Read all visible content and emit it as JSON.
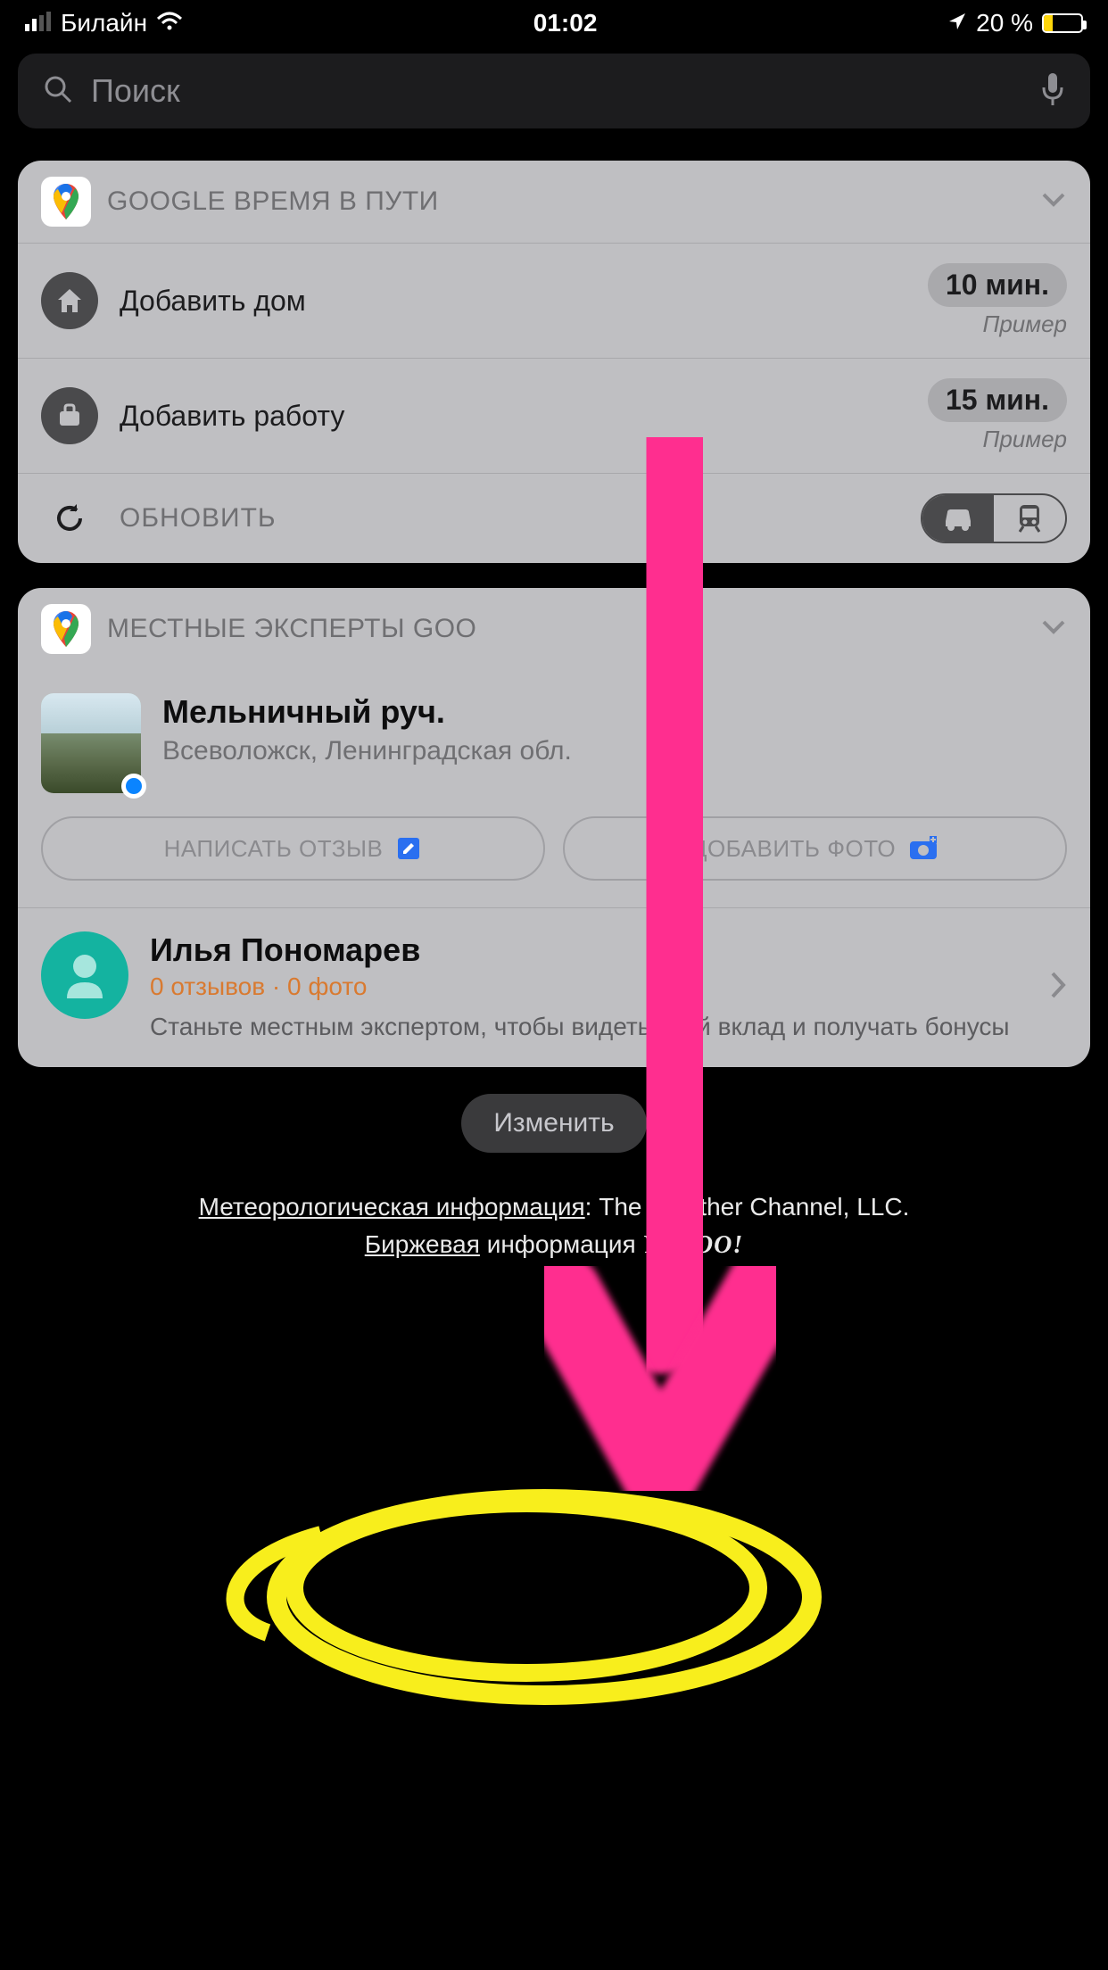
{
  "status": {
    "carrier": "Билайн",
    "time": "01:02",
    "battery_pct": "20 %"
  },
  "search": {
    "placeholder": "Поиск"
  },
  "commute": {
    "title": "GOOGLE ВРЕМЯ В ПУТИ",
    "home_label": "Добавить дом",
    "home_time": "10 мин.",
    "home_example": "Пример",
    "work_label": "Добавить работу",
    "work_time": "15 мин.",
    "work_example": "Пример",
    "refresh_label": "ОБНОВИТЬ"
  },
  "experts": {
    "title": "МЕСТНЫЕ ЭКСПЕРТЫ GOO",
    "place_title": "Мельничный руч.",
    "place_sub": "Всеволожск, Ленинградская обл.",
    "write_review": "НАПИСАТЬ ОТЗЫВ",
    "add_photo": "ДОБАВИТЬ ФОТО",
    "profile_name": "Илья Пономарев",
    "profile_stats": "0 отзывов · 0 фото",
    "profile_desc": "Станьте местным экспертом, чтобы видеть свой вклад и получать бонусы"
  },
  "edit_label": "Изменить",
  "footer": {
    "weather_link": "Метеорологическая информация",
    "weather_tail": ": The Weather Channel, LLC.",
    "stock_link": "Биржевая",
    "stock_tail": " информация ",
    "yahoo": "YAHOO!"
  }
}
